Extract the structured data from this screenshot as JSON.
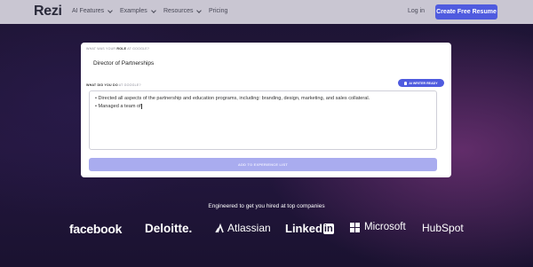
{
  "nav": {
    "logo": "Rezi",
    "items": [
      "AI Features",
      "Examples",
      "Resources",
      "Pricing"
    ],
    "login": "Log in",
    "cta": "Create Free Resume"
  },
  "form": {
    "role_label_prefix": "WHAT WAS YOUR ",
    "role_label_bold": "ROLE",
    "role_label_suffix": " AT GOOGLE?",
    "role_value": "Director of Partnerships",
    "did_label_prefix": "WHAT DID YOU DO",
    "did_label_suffix": " AT GOOGLE?",
    "ai_badge": "AI WRITER READY",
    "bullets": [
      "• Directed all aspects of the partnership and education programs, including: branding, design, marketing, and sales collateral.",
      "• Managed a team of"
    ],
    "add_button": "ADD TO EXPERIENCE LIST"
  },
  "companies": {
    "heading": "Engineered to get you hired at top companies",
    "logos": [
      "facebook",
      "Deloitte.",
      "Atlassian",
      "Linked",
      "in",
      "Microsoft",
      "HubSpot"
    ]
  },
  "colors": {
    "accent": "#4f5bdf",
    "nav_bg": "#c9c6d2",
    "page_bg": "#1d1433",
    "button_disabled": "#a9acef"
  }
}
